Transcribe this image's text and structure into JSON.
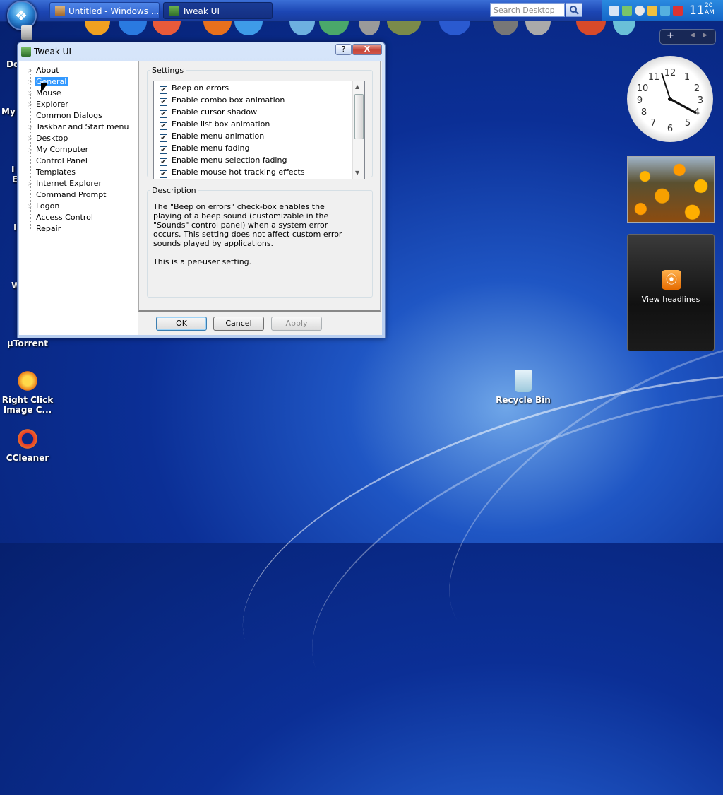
{
  "taskbar": {
    "tasks": [
      {
        "label": "Untitled - Windows ..."
      },
      {
        "label": "Tweak UI"
      }
    ],
    "search_placeholder": "Search Desktop",
    "clock_hour": "11",
    "clock_minute": "20",
    "clock_period": "AM"
  },
  "sidebar": {
    "feed_label": "View headlines"
  },
  "desktop": {
    "icons": [
      {
        "label": "µTorrent"
      },
      {
        "label": "Right Click Image C..."
      },
      {
        "label": "CCleaner"
      },
      {
        "label": "Recycle Bin"
      }
    ],
    "edge_labels": [
      "Do",
      "My",
      "I",
      "E",
      "I",
      "W"
    ]
  },
  "window": {
    "title": "Tweak UI",
    "help_label": "?",
    "close_label": "X",
    "tree": [
      {
        "label": "About"
      },
      {
        "label": "General"
      },
      {
        "label": "Mouse"
      },
      {
        "label": "Explorer"
      },
      {
        "label": "Common Dialogs"
      },
      {
        "label": "Taskbar and Start menu"
      },
      {
        "label": "Desktop"
      },
      {
        "label": "My Computer"
      },
      {
        "label": "Control Panel"
      },
      {
        "label": "Templates"
      },
      {
        "label": "Internet Explorer"
      },
      {
        "label": "Command Prompt"
      },
      {
        "label": "Logon"
      },
      {
        "label": "Access Control"
      },
      {
        "label": "Repair"
      }
    ],
    "settings_legend": "Settings",
    "settings": [
      {
        "label": "Beep on errors",
        "checked": true
      },
      {
        "label": "Enable combo box animation",
        "checked": true
      },
      {
        "label": "Enable cursor shadow",
        "checked": true
      },
      {
        "label": "Enable list box animation",
        "checked": true
      },
      {
        "label": "Enable menu animation",
        "checked": true
      },
      {
        "label": "Enable menu fading",
        "checked": true
      },
      {
        "label": "Enable menu selection fading",
        "checked": true
      },
      {
        "label": "Enable mouse hot tracking effects",
        "checked": true
      }
    ],
    "description_legend": "Description",
    "description_p1": "The \"Beep on errors\" check-box enables the playing of a beep sound (customizable in the \"Sounds\" control panel) when a system error occurs.  This setting does not affect custom error sounds played by applications.",
    "description_p2": "This is a per-user setting.",
    "ok_label": "OK",
    "cancel_label": "Cancel",
    "apply_label": "Apply",
    "check_mark": "✔"
  }
}
